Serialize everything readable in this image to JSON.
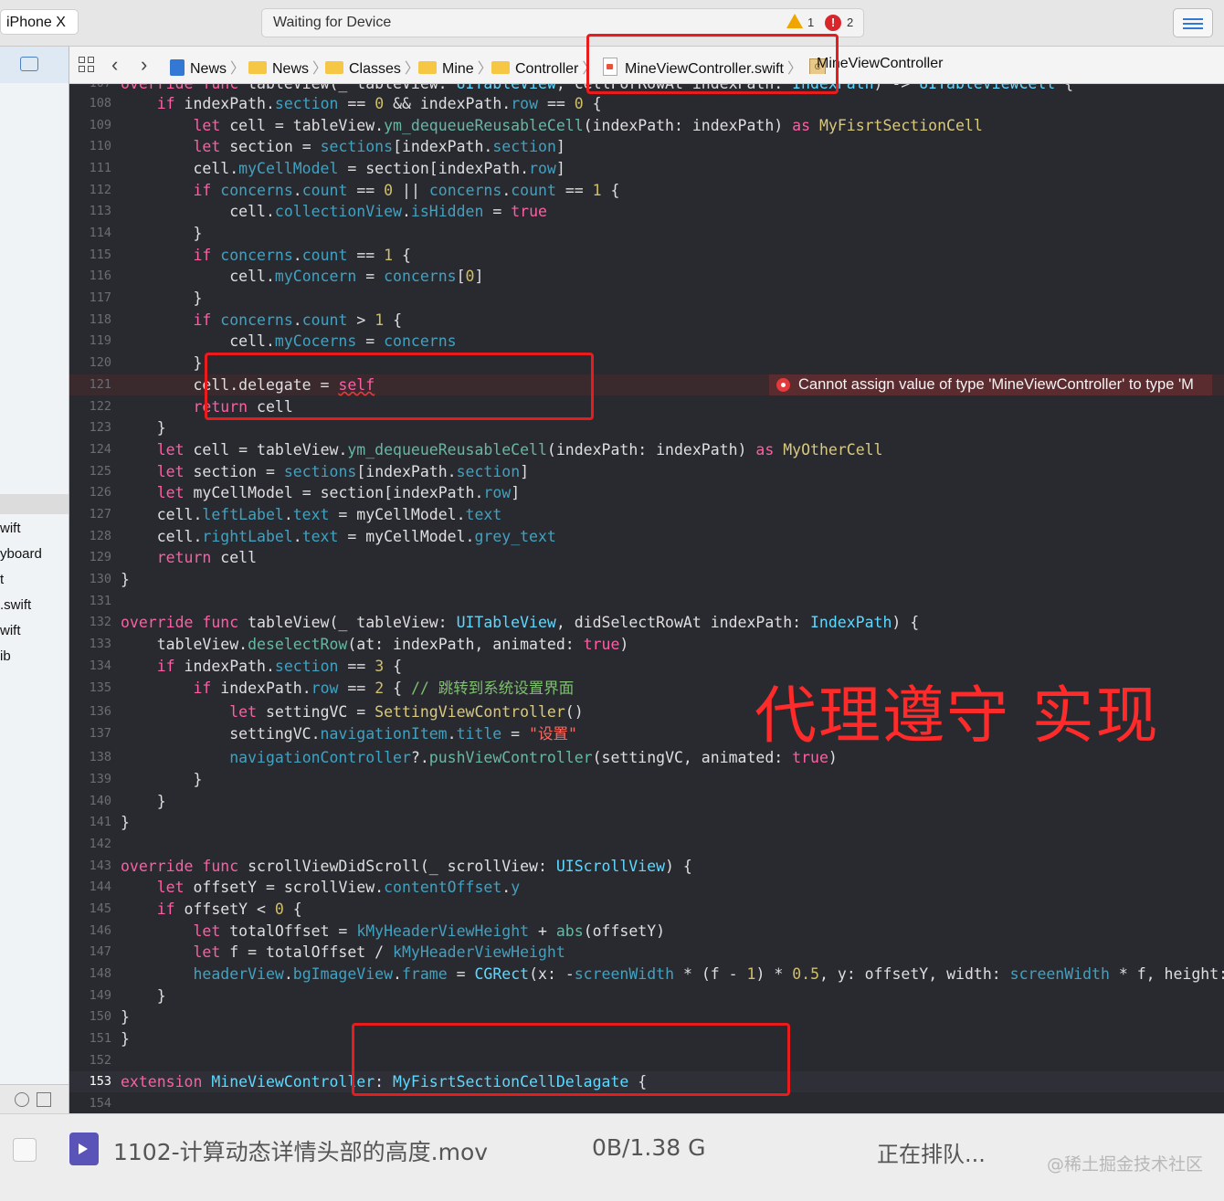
{
  "toolbar": {
    "scheme_device": "iPhone X",
    "status": "Waiting for Device",
    "warning_count": "1",
    "error_count": "2"
  },
  "jumpbar": {
    "crumbs": [
      "News",
      "News",
      "Classes",
      "Mine",
      "Controller",
      "MineViewController.swift",
      "MineViewController"
    ],
    "class_badge": "C"
  },
  "navigator": {
    "files": [
      "wift",
      "yboard",
      "t",
      ".swift",
      "wift",
      "ib"
    ]
  },
  "editor": {
    "error_line": "121",
    "error_message": "Cannot assign value of type 'MineViewController' to type 'M",
    "current_line": "153",
    "colors": {
      "background": "#292a30",
      "keyword": "#fc5fa3",
      "type": "#5dd8ff",
      "number": "#d0bf69",
      "error_line_bg": "#3a2a2d",
      "annotation": "#ff2a2a"
    }
  },
  "annotation_text": "代理遵守 实现",
  "download": {
    "filename": "1102-计算动态详情头部的高度.mov",
    "size": "0B/1.38 G",
    "status": "正在排队...",
    "watermark": "@稀土掘金技术社区"
  }
}
